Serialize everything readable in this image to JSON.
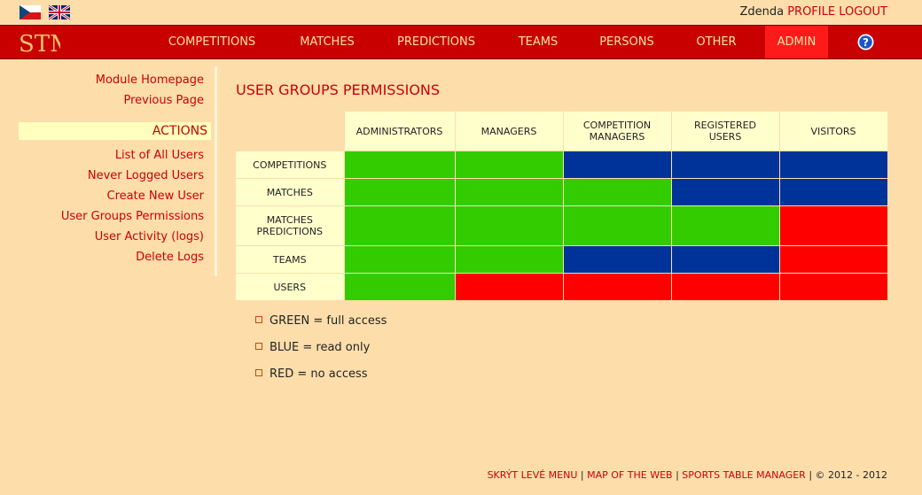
{
  "header": {
    "flags": [
      {
        "name": "czech-flag-icon"
      },
      {
        "name": "english-flag-icon"
      }
    ],
    "user": {
      "name": "Zdenda",
      "profile_label": "PROFILE",
      "logout_label": "LOGOUT"
    }
  },
  "menu": {
    "logo_text": "STM",
    "items": [
      {
        "label": "COMPETITIONS"
      },
      {
        "label": "MATCHES"
      },
      {
        "label": "PREDICTIONS"
      },
      {
        "label": "TEAMS"
      },
      {
        "label": "PERSONS"
      },
      {
        "label": "OTHER"
      },
      {
        "label": "ADMIN",
        "active": true
      }
    ],
    "help_icon": "help-icon"
  },
  "sidebar": {
    "links_top": [
      {
        "label": "Module Homepage"
      },
      {
        "label": "Previous Page"
      }
    ],
    "actions_heading": "ACTIONS",
    "actions": [
      {
        "label": "List of All Users"
      },
      {
        "label": "Never Logged Users"
      },
      {
        "label": "Create New User"
      },
      {
        "label": "User Groups Permissions"
      },
      {
        "label": "User Activity (logs)"
      },
      {
        "label": "Delete Logs"
      }
    ]
  },
  "main": {
    "title": "USER GROUPS PERMISSIONS",
    "table": {
      "columns": [
        {
          "line1": "ADMINISTRATORS",
          "line2": ""
        },
        {
          "line1": "MANAGERS",
          "line2": ""
        },
        {
          "line1": "COMPETITION",
          "line2": "MANAGERS"
        },
        {
          "line1": "REGISTERED",
          "line2": "USERS"
        },
        {
          "line1": "VISITORS",
          "line2": ""
        }
      ],
      "rows": [
        {
          "line1": "COMPETITIONS",
          "line2": "",
          "access": [
            "full",
            "full",
            "read",
            "read",
            "read"
          ]
        },
        {
          "line1": "MATCHES",
          "line2": "",
          "access": [
            "full",
            "full",
            "full",
            "read",
            "read"
          ]
        },
        {
          "line1": "MATCHES",
          "line2": "PREDICTIONS",
          "access": [
            "full",
            "full",
            "full",
            "full",
            "none"
          ]
        },
        {
          "line1": "TEAMS",
          "line2": "",
          "access": [
            "full",
            "full",
            "read",
            "read",
            "none"
          ]
        },
        {
          "line1": "USERS",
          "line2": "",
          "access": [
            "full",
            "none",
            "none",
            "none",
            "none"
          ]
        }
      ]
    },
    "colors": {
      "full": "#33cc00",
      "read": "#003399",
      "none": "#ff0000"
    },
    "legend": [
      {
        "text": "GREEN = full access"
      },
      {
        "text": "BLUE = read only"
      },
      {
        "text": "RED = no access"
      }
    ]
  },
  "footer": {
    "hide_menu": "SKRÝT LEVÉ MENU",
    "sitemap": "MAP OF THE WEB",
    "app_name": "SPORTS TABLE MANAGER",
    "copyright": "© 2012 - 2012",
    "separator": "|"
  }
}
